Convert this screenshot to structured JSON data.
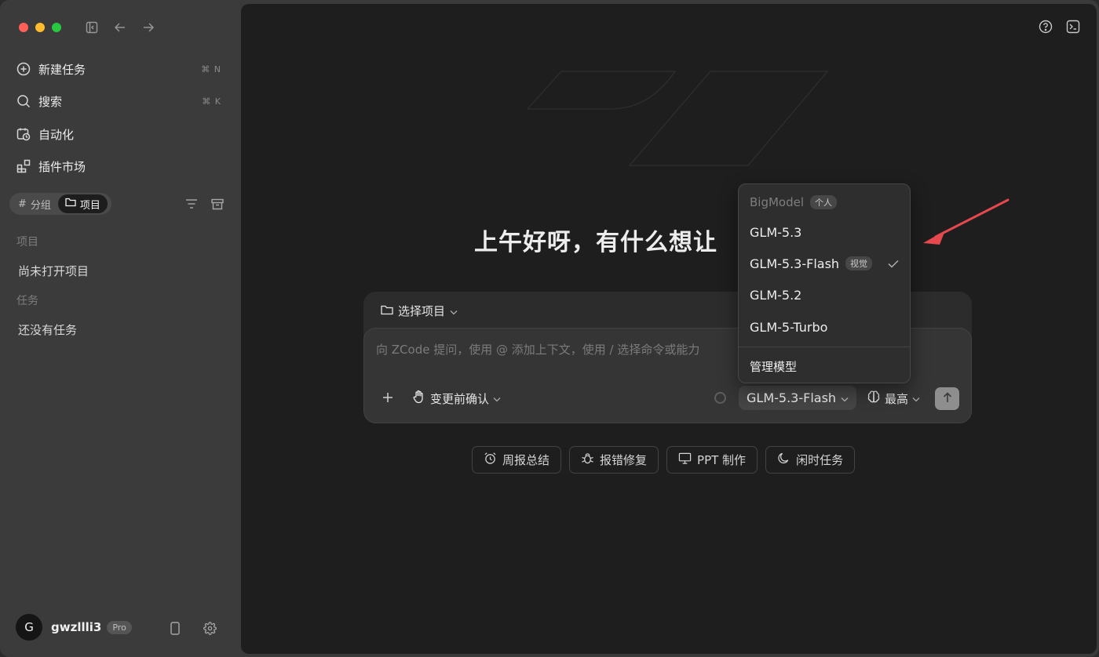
{
  "sidebar": {
    "nav": [
      {
        "label": "新建任务",
        "shortcut": "⌘ N",
        "icon": "plus-circle-icon"
      },
      {
        "label": "搜索",
        "shortcut": "⌘ K",
        "icon": "search-icon"
      },
      {
        "label": "自动化",
        "shortcut": "",
        "icon": "calendar-clock-icon"
      },
      {
        "label": "插件市场",
        "shortcut": "",
        "icon": "grid-plus-icon"
      }
    ],
    "segments": [
      {
        "label": "分组",
        "prefix": "#",
        "active": false
      },
      {
        "label": "项目",
        "active": true
      }
    ],
    "projects_title": "项目",
    "projects_empty": "尚未打开项目",
    "tasks_title": "任务",
    "tasks_empty": "还没有任务",
    "user": {
      "initial": "G",
      "name": "gwzllli3",
      "badge": "Pro"
    }
  },
  "main": {
    "greeting": "上午好呀，有什么想让",
    "composer": {
      "project_selector": "选择项目",
      "placeholder": "向 ZCode 提问，使用 @ 添加上下文，使用 / 选择命令或能力",
      "confirm_mode": "变更前确认",
      "model": "GLM-5.3-Flash",
      "level": "最高"
    },
    "quick_actions": [
      {
        "label": "周报总结",
        "icon": "alarm-clock-icon"
      },
      {
        "label": "报错修复",
        "icon": "bug-icon"
      },
      {
        "label": "PPT 制作",
        "icon": "presentation-icon"
      },
      {
        "label": "闲时任务",
        "icon": "moon-icon"
      }
    ]
  },
  "dropdown": {
    "provider": "BigModel",
    "provider_tag": "个人",
    "models": [
      {
        "name": "GLM-5.3",
        "tag": "",
        "selected": false
      },
      {
        "name": "GLM-5.3-Flash",
        "tag": "视觉",
        "selected": true
      },
      {
        "name": "GLM-5.2",
        "tag": "",
        "selected": false
      },
      {
        "name": "GLM-5-Turbo",
        "tag": "",
        "selected": false
      }
    ],
    "manage": "管理模型"
  },
  "colors": {
    "annotation_arrow": "#e5484d"
  }
}
